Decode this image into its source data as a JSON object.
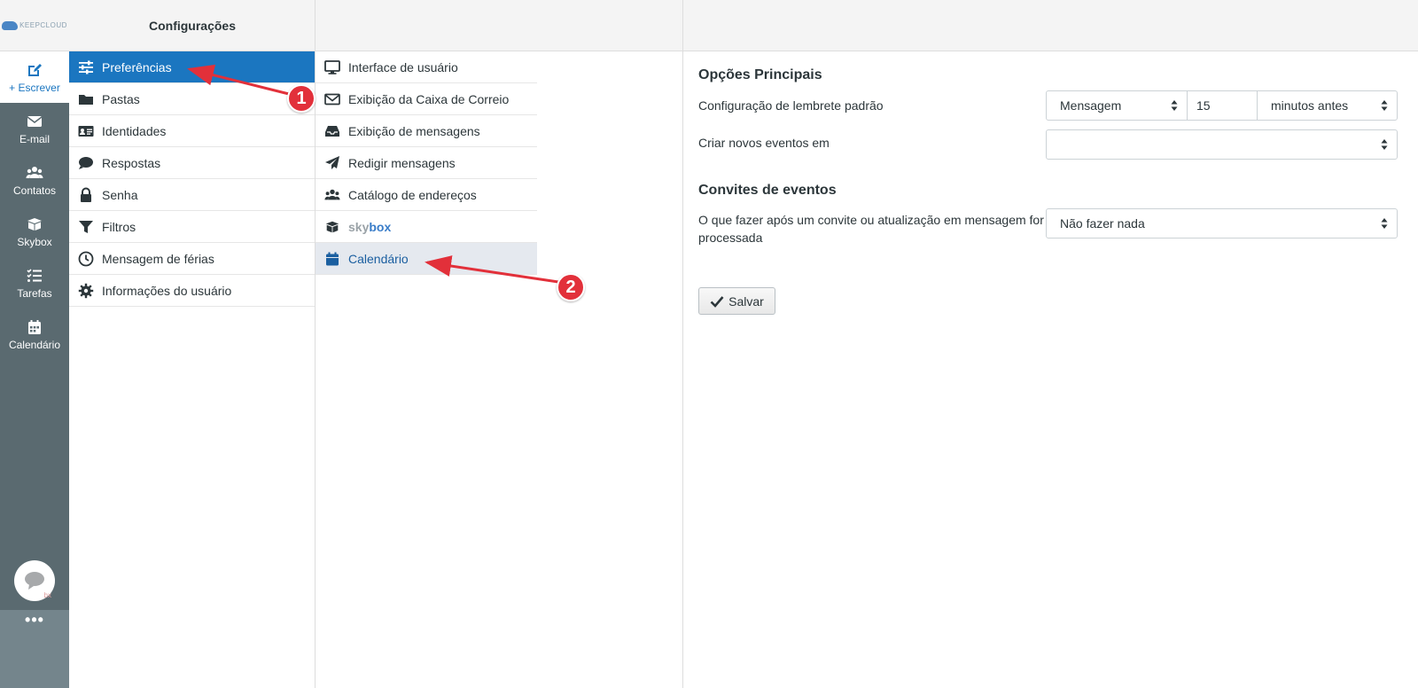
{
  "brand": {
    "logo_text": "KEEPCLOUD"
  },
  "header": {
    "title": "Configurações"
  },
  "navbar": {
    "compose": "+ Escrever",
    "items": [
      {
        "label": "E-mail",
        "icon": "envelope-icon"
      },
      {
        "label": "Contatos",
        "icon": "users-icon"
      },
      {
        "label": "Skybox",
        "icon": "box-icon"
      },
      {
        "label": "Tarefas",
        "icon": "tasks-icon"
      },
      {
        "label": "Calendário",
        "icon": "calendar-icon"
      }
    ],
    "chat_badge": "bx",
    "more": "•••"
  },
  "settings": {
    "items": [
      {
        "label": "Preferências",
        "icon": "sliders-icon"
      },
      {
        "label": "Pastas",
        "icon": "folder-icon"
      },
      {
        "label": "Identidades",
        "icon": "id-card-icon"
      },
      {
        "label": "Respostas",
        "icon": "comment-icon"
      },
      {
        "label": "Senha",
        "icon": "lock-icon"
      },
      {
        "label": "Filtros",
        "icon": "filter-icon"
      },
      {
        "label": "Mensagem de férias",
        "icon": "clock-icon"
      },
      {
        "label": "Informações do usuário",
        "icon": "gear-icon"
      }
    ]
  },
  "sections": {
    "items": [
      {
        "label": "Interface de usuário",
        "icon": "monitor-icon"
      },
      {
        "label": "Exibição da Caixa de Correio",
        "icon": "envelope-outline-icon"
      },
      {
        "label": "Exibição de mensagens",
        "icon": "inbox-icon"
      },
      {
        "label": "Redigir mensagens",
        "icon": "paper-plane-icon"
      },
      {
        "label": "Catálogo de endereços",
        "icon": "users-icon"
      },
      {
        "label_sky": "sky",
        "label_box": "box",
        "icon": "skybox-icon"
      },
      {
        "label": "Calendário",
        "icon": "calendar-icon"
      }
    ]
  },
  "content": {
    "main_title": "Opções Principais",
    "reminder_label": "Configuração de lembrete padrão",
    "reminder_type": "Mensagem",
    "reminder_value": "15",
    "reminder_unit": "minutos antes",
    "new_events_label": "Criar novos eventos em",
    "new_events_value": "",
    "invites_title": "Convites de eventos",
    "invites_label": "O que fazer após um convite ou atualização em mensagem for processada",
    "invites_value": "Não fazer nada",
    "save_label": "Salvar"
  },
  "annotations": {
    "one": "1",
    "two": "2"
  },
  "colors": {
    "accent": "#1b76c0",
    "navbar": "#5a6a70",
    "annotation": "#e2303a"
  }
}
